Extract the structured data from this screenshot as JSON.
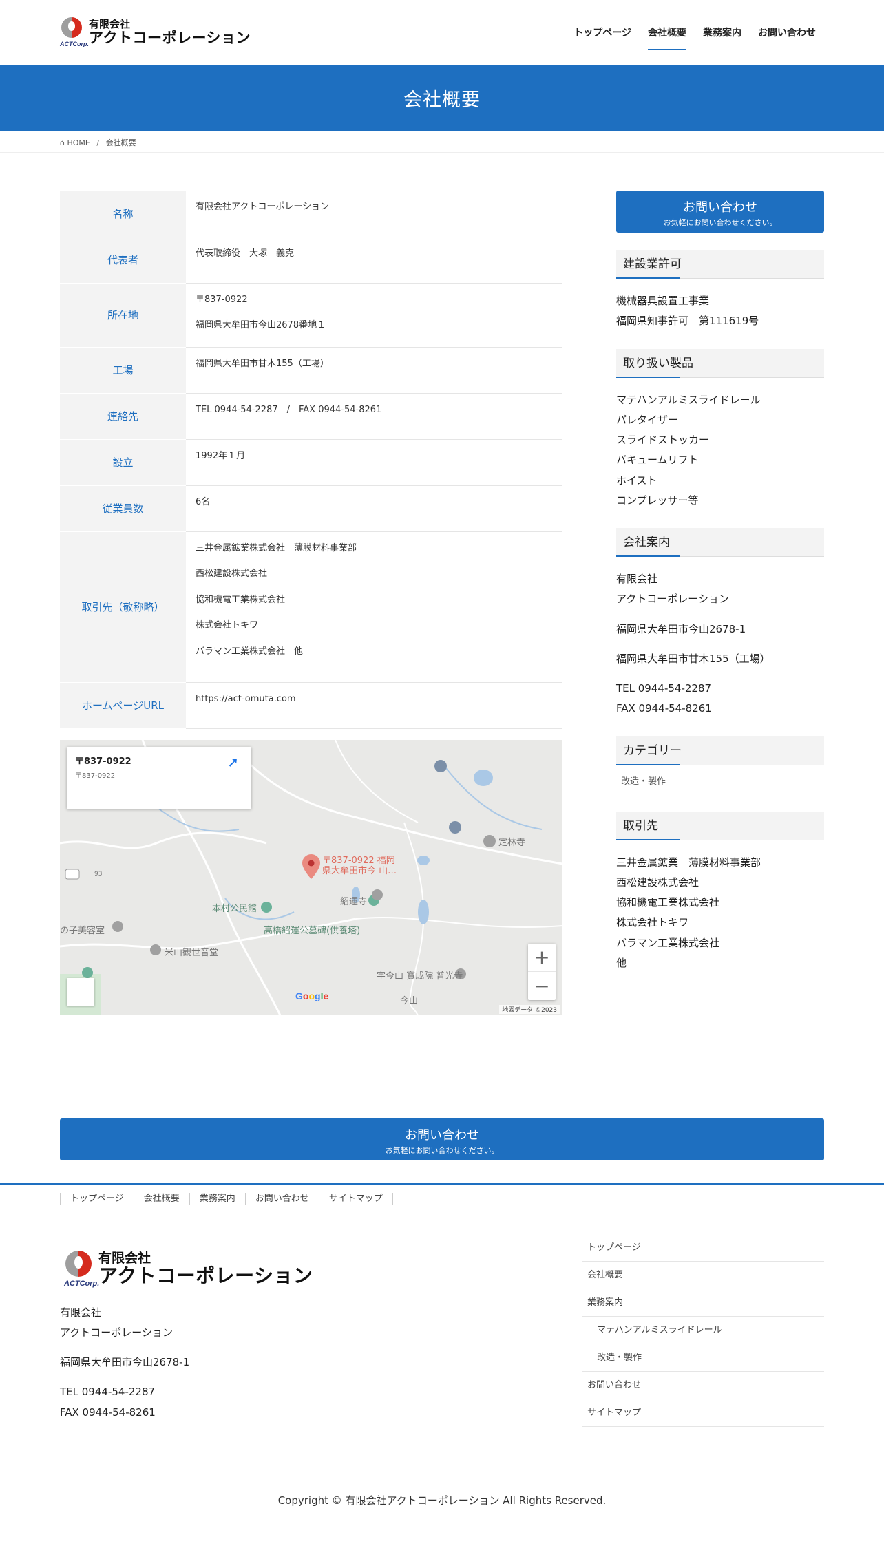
{
  "header": {
    "logo_line1": "有限会社",
    "logo_line2": "アクトコーポレーション",
    "logo_corp": "ACTCorp.",
    "nav": [
      "トップページ",
      "会社概要",
      "業務案内",
      "お問い合わせ"
    ]
  },
  "page_title": "会社概要",
  "breadcrumb": {
    "home": "HOME",
    "current": "会社概要"
  },
  "company_table": {
    "name_label": "名称",
    "name_value": "有限会社アクトコーポレーション",
    "rep_label": "代表者",
    "rep_value": "代表取締役　大塚　義克",
    "addr_label": "所在地",
    "addr_zip": "〒837-0922",
    "addr_value": "福岡県大牟田市今山2678番地１",
    "factory_label": "工場",
    "factory_value": "福岡県大牟田市甘木155（工場）",
    "contact_label": "連絡先",
    "contact_value": "TEL 0944-54-2287　/　FAX 0944-54-8261",
    "founded_label": "設立",
    "founded_value": "1992年１月",
    "staff_label": "従業員数",
    "staff_value": "6名",
    "partners_label": "取引先（敬称略）",
    "partners": [
      "三井金属鉱業株式会社　薄膜材料事業部",
      "西松建設株式会社",
      "協和機電工業株式会社",
      "株式会社トキワ",
      "バラマン工業株式会社　他"
    ],
    "url_label": "ホームページURL",
    "url_value": "https://act-omuta.com"
  },
  "map": {
    "card_title": "〒837-0922 ",
    "card_sub": "〒837-0922 ",
    "card_link": "",
    "pin_label1": "〒837-0922 福岡",
    "pin_label2": "県大牟田市今 山…",
    "labels": {
      "joren": "定林寺",
      "motomura": "本村公民館",
      "shoun": "紹運寺",
      "takahashi": "高橋紹運公墓碑(供養塔)",
      "biyou": "の子美容室",
      "yoneyama": "米山観世音堂",
      "imayama": "宇今山 寶成院 普光寺",
      "imayama2": "今山",
      "road": "93"
    },
    "zoom_in": "+",
    "zoom_out": "−",
    "google": "Google",
    "footer": "地図データ ©2023"
  },
  "cta": {
    "title": " お問い合わせ ",
    "sub": "お気軽にお問い合わせください。"
  },
  "sidebar": {
    "license_title": "建設業許可",
    "license_lines": [
      "機械器具設置工事業",
      "福岡県知事許可　第111619号"
    ],
    "products_title": "取り扱い製品",
    "products": [
      "マテハンアルミスライドレール",
      "パレタイザー",
      "スライドストッカー",
      "バキュームリフト",
      "ホイスト",
      "コンプレッサー等"
    ],
    "company_title": "会社案内",
    "company_name1": "有限会社",
    "company_name2": "アクトコーポレーション",
    "company_addr": "福岡県大牟田市今山2678-1",
    "company_factory": "福岡県大牟田市甘木155（工場）",
    "company_tel": "TEL 0944-54-2287",
    "company_fax": "FAX 0944-54-8261",
    "category_title": "カテゴリー",
    "category_item": "改造・製作",
    "clients_title": "取引先",
    "clients": [
      "三井金属鉱業　薄膜材料事業部",
      "西松建設株式会社",
      "協和機電工業株式会社",
      "株式会社トキワ",
      "バラマン工業株式会社",
      "他"
    ]
  },
  "footer": {
    "nav": [
      "トップページ",
      "会社概要",
      "業務案内",
      "お問い合わせ",
      "サイトマップ"
    ],
    "name1": "有限会社",
    "name2": "アクトコーポレーション",
    "addr": "福岡県大牟田市今山2678-1",
    "tel": "TEL 0944-54-2287",
    "fax": "FAX 0944-54-8261",
    "menu": [
      "トップページ",
      "会社概要",
      "業務案内",
      "マテハンアルミスライドレール",
      "改造・製作",
      "お問い合わせ",
      "サイトマップ"
    ],
    "copyright": "Copyright © 有限会社アクトコーポレーション All Rights Reserved."
  },
  "colors": {
    "primary": "#1e6fc0",
    "table_head_bg": "#f3f3f3"
  }
}
